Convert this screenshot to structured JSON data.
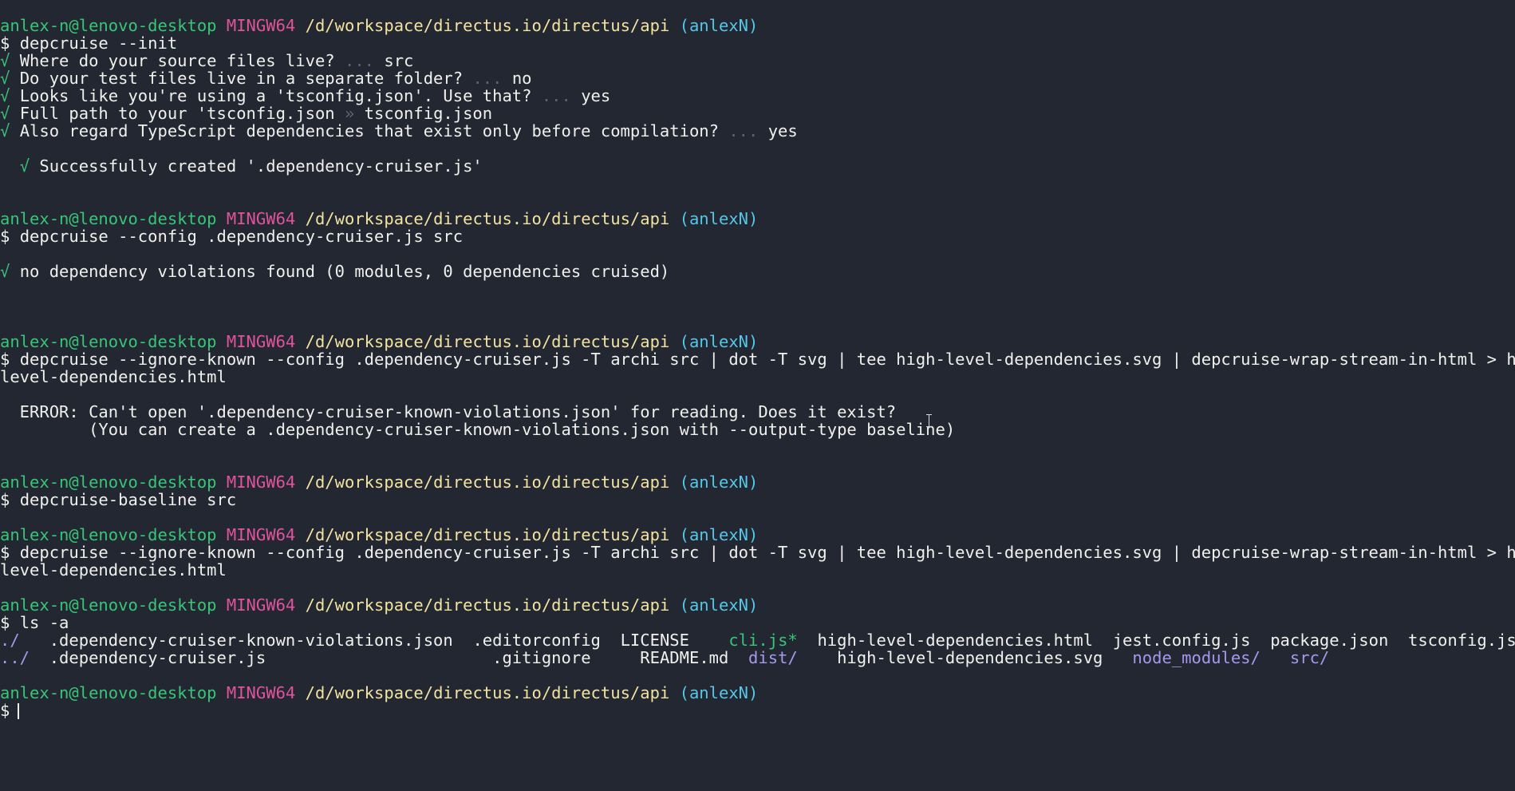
{
  "prompt": {
    "user_host": "anlex-n@lenovo-desktop",
    "system": "MINGW64",
    "path": "/d/workspace/directus.io/directus/api",
    "branch": "(anlexN)",
    "symbol": "$"
  },
  "check": "√",
  "block1": {
    "command": "depcruise --init",
    "q1": "Where do your source files live?",
    "a1": "src",
    "q2": "Do your test files live in a separate folder?",
    "a2": "no",
    "q3": "Looks like you're using a 'tsconfig.json'. Use that?",
    "a3": "yes",
    "q4": "Full path to your 'tsconfig.json",
    "a4": "tsconfig.json",
    "q5": "Also regard TypeScript dependencies that exist only before compilation?",
    "a5": "yes",
    "ellipsis": "...",
    "arrow": "»",
    "success": "Successfully created '.dependency-cruiser.js'"
  },
  "block2": {
    "command": "depcruise --config .dependency-cruiser.js src",
    "result": "no dependency violations found (0 modules, 0 dependencies cruised)"
  },
  "block3": {
    "command_line1": "depcruise --ignore-known --config .dependency-cruiser.js -T archi src | dot -T svg | tee high-level-dependencies.svg | depcruise-wrap-stream-in-html > high-",
    "command_line2": "level-dependencies.html",
    "error_line1": "  ERROR: Can't open '.dependency-cruiser-known-violations.json' for reading. Does it exist?",
    "error_line2": "         (You can create a .dependency-cruiser-known-violations.json with --output-type baseline)"
  },
  "block4": {
    "command": "depcruise-baseline src"
  },
  "block5": {
    "command_line1": "depcruise --ignore-known --config .dependency-cruiser.js -T archi src | dot -T svg | tee high-level-dependencies.svg | depcruise-wrap-stream-in-html > high-",
    "command_line2": "level-dependencies.html"
  },
  "block6": {
    "command": "ls -a",
    "row1": [
      {
        "text": "./",
        "kind": "dir",
        "pad": "   "
      },
      {
        "text": ".dependency-cruiser-known-violations.json",
        "kind": "file",
        "pad": "  "
      },
      {
        "text": ".editorconfig",
        "kind": "file",
        "pad": "  "
      },
      {
        "text": "LICENSE",
        "kind": "file",
        "pad": "    "
      },
      {
        "text": "cli.js*",
        "kind": "exec",
        "pad": "  "
      },
      {
        "text": "high-level-dependencies.html",
        "kind": "file",
        "pad": "  "
      },
      {
        "text": "jest.config.js",
        "kind": "file",
        "pad": "  "
      },
      {
        "text": "package.json",
        "kind": "file",
        "pad": "  "
      },
      {
        "text": "tsconfig.json",
        "kind": "file",
        "pad": ""
      }
    ],
    "row2": [
      {
        "text": "../",
        "kind": "dir",
        "pad": "  "
      },
      {
        "text": ".dependency-cruiser.js",
        "kind": "file",
        "pad": "                       "
      },
      {
        "text": ".gitignore",
        "kind": "file",
        "pad": "     "
      },
      {
        "text": "README.md",
        "kind": "file",
        "pad": "  "
      },
      {
        "text": "dist/",
        "kind": "dir",
        "pad": "    "
      },
      {
        "text": "high-level-dependencies.svg",
        "kind": "file",
        "pad": "   "
      },
      {
        "text": "node_modules/",
        "kind": "dir",
        "pad": "   "
      },
      {
        "text": "src/",
        "kind": "dir",
        "pad": ""
      }
    ]
  },
  "colors": {
    "background": "#232731",
    "user_host": "#38c578",
    "system": "#e0539d",
    "path": "#f2e3a0",
    "branch": "#55c7e8",
    "dir": "#a897ee",
    "exec": "#38c578",
    "dim": "#5d6371"
  }
}
